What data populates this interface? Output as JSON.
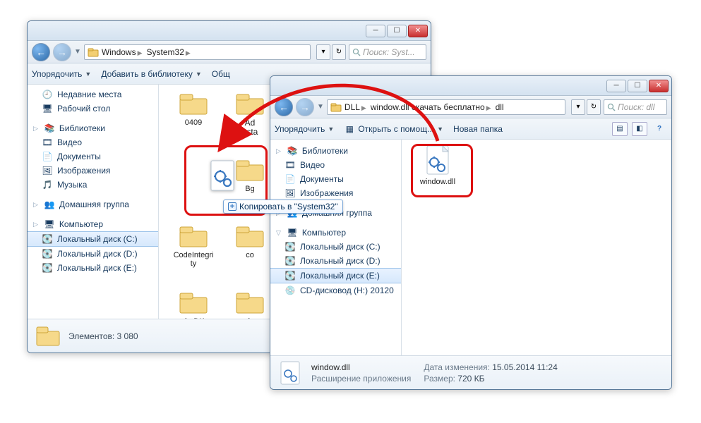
{
  "win1": {
    "breadcrumbs": [
      "Windows",
      "System32"
    ],
    "search_placeholder": "Поиск: Syst...",
    "toolbar": {
      "organize": "Упорядочить",
      "addlib": "Добавить в библиотеку",
      "share_trunc": "Общ"
    },
    "nav": {
      "recent": "Недавние места",
      "desktop": "Рабочий стол",
      "lib_group": "Библиотеки",
      "video": "Видео",
      "docs": "Документы",
      "images": "Изображения",
      "music": "Музыка",
      "homegroup": "Домашняя группа",
      "computer": "Компьютер",
      "disk_c": "Локальный диск (C:)",
      "disk_d": "Локальный диск (D:)",
      "disk_e": "Локальный диск (E:)"
    },
    "files": {
      "f1": "0409",
      "f2_a": "Ad",
      "f2_b": "nsta",
      "f3": "bg-BG",
      "f3_trunc": "Bg",
      "f4": "CodeIntegri\nty",
      "f5": "co",
      "f6": "da-DK",
      "f7": "de"
    },
    "status": {
      "elements_label": "Элементов:",
      "elements_count": "3 080"
    }
  },
  "win2": {
    "breadcrumbs": [
      "DLL",
      "window.dll скачать бесплатно",
      "dll"
    ],
    "search_placeholder": "Поиск: dll",
    "toolbar": {
      "organize": "Упорядочить",
      "openwith": "Открыть с помощ...",
      "newfolder": "Новая папка"
    },
    "nav": {
      "lib_group": "Библиотеки",
      "video": "Видео",
      "docs": "Документы",
      "images": "Изображения",
      "homegroup": "Домашняя группа",
      "computer": "Компьютер",
      "disk_c": "Локальный диск (C:)",
      "disk_d": "Локальный диск (D:)",
      "disk_e": "Локальный диск (E:)",
      "cd": "CD-дисковод (H:) 20120"
    },
    "file": {
      "name": "window.dll"
    },
    "status": {
      "name": "window.dll",
      "type": "Расширение приложения",
      "mod_label": "Дата изменения:",
      "mod_value": "15.05.2014 11:24",
      "size_label": "Размер:",
      "size_value": "720 КБ"
    }
  },
  "tooltip": {
    "text": "Копировать в \"System32\""
  }
}
